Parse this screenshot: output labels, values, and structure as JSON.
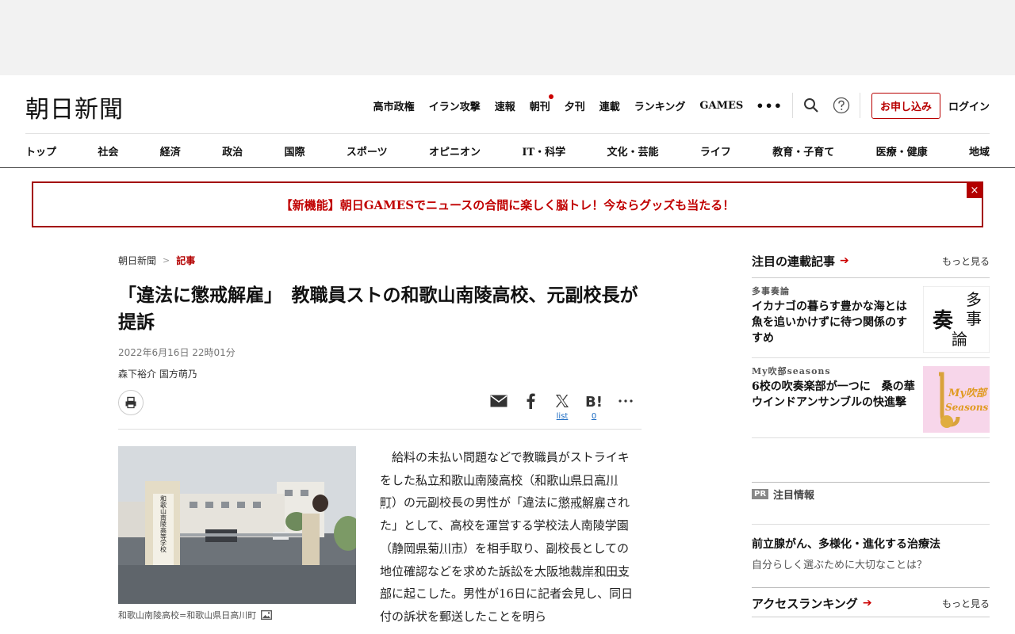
{
  "header": {
    "logo": "朝日新聞",
    "top_links": [
      "高市政権",
      "イラン攻撃",
      "速報",
      "朝刊",
      "夕刊",
      "連載",
      "ランキング",
      "GAMES"
    ],
    "more": "•••",
    "subscribe": "お申し込み",
    "login": "ログイン"
  },
  "categories": [
    "トップ",
    "社会",
    "経済",
    "政治",
    "国際",
    "スポーツ",
    "オピニオン",
    "IT・科学",
    "文化・芸能",
    "ライフ",
    "教育・子育て",
    "医療・健康",
    "地域"
  ],
  "banner": {
    "text": "【新機能】朝日GAMESでニュースの合間に楽しく脳トレ！今ならグッズも当たる！",
    "close": "×"
  },
  "article": {
    "breadcrumb_home": "朝日新聞",
    "breadcrumb_sep": ">",
    "breadcrumb_current": "記事",
    "title": "「違法に懲戒解雇」　教職員ストの和歌山南陵高校、元副校長が提訴",
    "date": "2022年6月16日 22時01分",
    "authors": "森下裕介 国方萌乃",
    "share_counts": {
      "x": "list",
      "hatena": "0"
    },
    "photo_caption": "和歌山南陵高校=和歌山県日高川町",
    "photo_sign": "和歌山南陵高等学校",
    "body": {
      "p1": "給料の未払い問題などで教職員がストライキをした",
      "u1": "私立",
      "p2": "",
      "u2": "和歌山南陵高校",
      "p3": "（",
      "u3": "和歌山県日高川町",
      "p4": "）の元副校長の男性が「違法に",
      "u4": "懲戒解雇",
      "p5": "された」として、高校を運営する学校法人南陵学園（",
      "u5": "静岡県菊川市",
      "p6": "）を相手取り、副校長としての地位確認などを求めた",
      "u6": "訴訟",
      "p7": "を",
      "u7": "大阪地裁岸和田支部",
      "p8": "に起こした。男性が16日に記者会見し、同日付の訴状を郵送したことを明ら"
    }
  },
  "sidebar": {
    "series_heading": "注目の連載記事",
    "series_more": "もっと見る",
    "series": [
      {
        "label": "多事奏論",
        "title": "イカナゴの暮らす豊かな海とは　魚を追いかけずに待つ関係のすすめ",
        "thumb_text": [
          "多",
          "事",
          "奏",
          "論"
        ]
      },
      {
        "label": "My吹部seasons",
        "title": "6校の吹奏楽部が一つに　桑の華ウインドアンサンブルの快進撃",
        "thumb_text": [
          "My吹部",
          "Seasons"
        ]
      }
    ],
    "pr_badge": "PR",
    "pr_heading": "注目情報",
    "pr_title": "前立腺がん、多様化・進化する治療法",
    "pr_sub": "自分らしく選ぶために大切なことは？",
    "ranking_heading": "アクセスランキング",
    "ranking_more": "もっと見る"
  },
  "colors": {
    "accent": "#b30000",
    "link": "#1a6ac2"
  }
}
